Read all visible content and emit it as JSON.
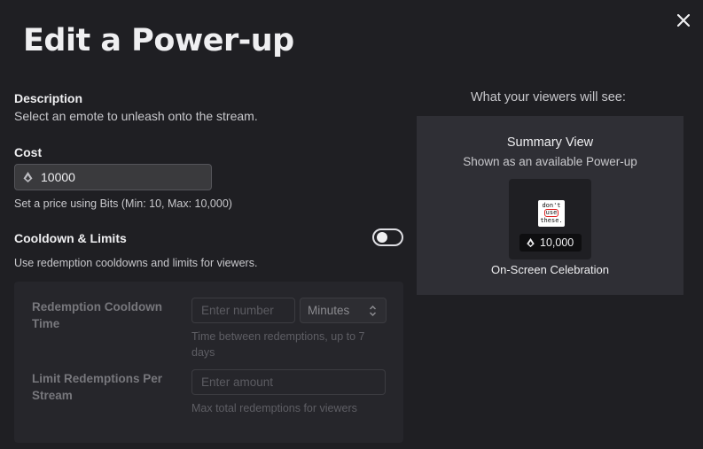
{
  "dialog": {
    "title": "Edit a Power-up",
    "close_icon": "close-icon"
  },
  "description": {
    "label": "Description",
    "text": "Select an emote to unleash onto the stream."
  },
  "cost": {
    "label": "Cost",
    "value": "10000",
    "icon": "bits-icon",
    "help": "Set a price using Bits (Min: 10, Max: 10,000)"
  },
  "cooldown": {
    "label": "Cooldown & Limits",
    "enabled": false,
    "help": "Use redemption cooldowns and limits for viewers.",
    "redemption_cooldown": {
      "label_line1": "Redemption Cooldown",
      "label_line2": "Time",
      "placeholder": "Enter number",
      "unit": "Minutes",
      "help_line1": "Time between redemptions, up to 7",
      "help_line2": "days"
    },
    "limit_per_stream": {
      "label_line1": "Limit Redemptions Per",
      "label_line2": "Stream",
      "placeholder": "Enter amount",
      "help": "Max total redemptions for viewers"
    }
  },
  "preview": {
    "heading": "What your viewers will see:",
    "title": "Summary View",
    "subtitle": "Shown as an available Power-up",
    "emote_lines": [
      "don't",
      "use",
      "these."
    ],
    "price": "10,000",
    "name": "On-Screen Celebration"
  },
  "colors": {
    "background": "#1f1f23",
    "preview_card": "#2f2f35",
    "input": "#3a3a3d"
  }
}
